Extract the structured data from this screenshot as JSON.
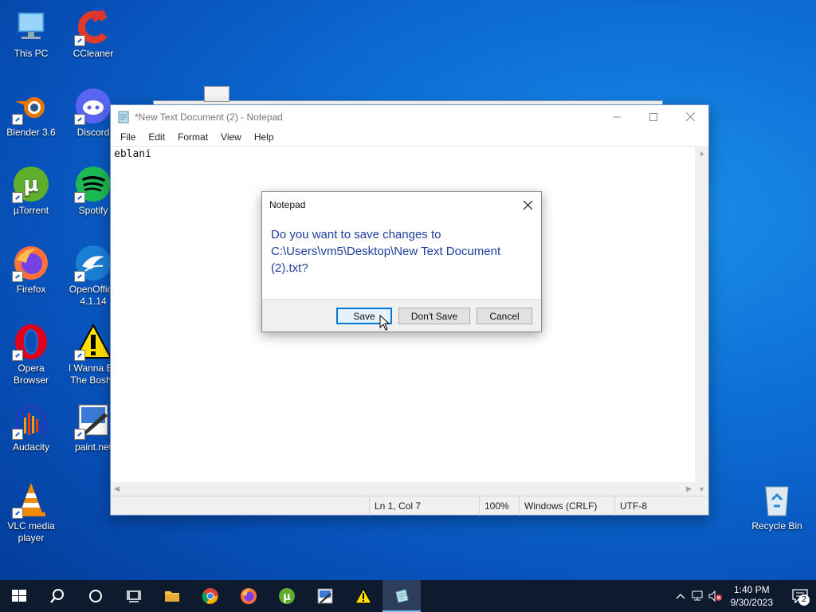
{
  "desktop_icons": [
    {
      "label": "This PC",
      "icon": "computer-icon"
    },
    {
      "label": "CCleaner",
      "icon": "ccleaner-icon"
    },
    {
      "label": "Blender 3.6",
      "icon": "blender-icon"
    },
    {
      "label": "Discord",
      "icon": "discord-icon"
    },
    {
      "label": "µTorrent",
      "icon": "utorrent-icon"
    },
    {
      "label": "Spotify",
      "icon": "spotify-icon"
    },
    {
      "label": "Firefox",
      "icon": "firefox-icon"
    },
    {
      "label": "OpenOffice 4.1.14",
      "icon": "openoffice-icon"
    },
    {
      "label": "Opera Browser",
      "icon": "opera-icon"
    },
    {
      "label": "I Wanna Be The Boshy",
      "icon": "warning-icon"
    },
    {
      "label": "Audacity",
      "icon": "audacity-icon"
    },
    {
      "label": "paint.net",
      "icon": "paintnet-icon"
    },
    {
      "label": "VLC media player",
      "icon": "vlc-icon"
    },
    {
      "label": "Recycle Bin",
      "icon": "recycle-bin-icon"
    }
  ],
  "notepad": {
    "title": "*New Text Document (2) - Notepad",
    "menu": [
      "File",
      "Edit",
      "Format",
      "View",
      "Help"
    ],
    "content": "eblani",
    "status": {
      "position": "Ln 1, Col 7",
      "zoom": "100%",
      "line_ending": "Windows (CRLF)",
      "encoding": "UTF-8"
    }
  },
  "dialog": {
    "title": "Notepad",
    "message": "Do you want to save changes to C:\\Users\\vm5\\Desktop\\New Text Document (2).txt?",
    "buttons": {
      "save": "Save",
      "dont_save": "Don't Save",
      "cancel": "Cancel"
    }
  },
  "taskbar": {
    "time": "1:40 PM",
    "date": "9/30/2023",
    "notification_count": "2"
  },
  "colors": {
    "accent": "#0078d7",
    "dialog_message": "#1e3f9e",
    "taskbar": "#0e1a2e"
  }
}
